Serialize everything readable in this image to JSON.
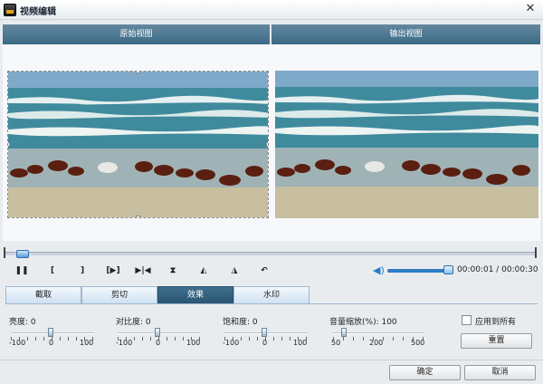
{
  "window": {
    "title": "视频编辑",
    "close_icon": "close-icon"
  },
  "panels": {
    "original": "原始视图",
    "output": "输出视图"
  },
  "player": {
    "controls": [
      {
        "name": "pause",
        "glyph": "❚❚"
      },
      {
        "name": "mark-in",
        "glyph": "["
      },
      {
        "name": "mark-out",
        "glyph": "]"
      },
      {
        "name": "play-segment",
        "glyph": "[▶]"
      },
      {
        "name": "step",
        "glyph": "▶|◀"
      },
      {
        "name": "flip-vertical",
        "glyph": "⧗"
      },
      {
        "name": "rotate-left",
        "glyph": "◭"
      },
      {
        "name": "rotate-right",
        "glyph": "◮"
      },
      {
        "name": "undo",
        "glyph": "↶"
      }
    ],
    "time": "00:00:01 / 00:00:30",
    "volume_level": 0.9
  },
  "tabs": [
    {
      "label": "截取",
      "active": false
    },
    {
      "label": "剪切",
      "active": false
    },
    {
      "label": "效果",
      "active": true
    },
    {
      "label": "水印",
      "active": false
    }
  ],
  "effects": {
    "brightness": {
      "label": "亮度: 0",
      "min": "-100",
      "mid": "0",
      "max": "100",
      "value": 0
    },
    "contrast": {
      "label": "对比度: 0",
      "min": "-100",
      "mid": "0",
      "max": "100",
      "value": 0
    },
    "saturation": {
      "label": "饱和度: 0",
      "min": "-100",
      "mid": "0",
      "max": "100",
      "value": 0
    },
    "volume": {
      "label": "音量缩放(%): 100",
      "min": "50",
      "mid": "200",
      "max": "500",
      "value": 100
    }
  },
  "apply_all_label": "应用到所有",
  "reset_label": "重置",
  "ok_label": "确定",
  "cancel_label": "取消"
}
